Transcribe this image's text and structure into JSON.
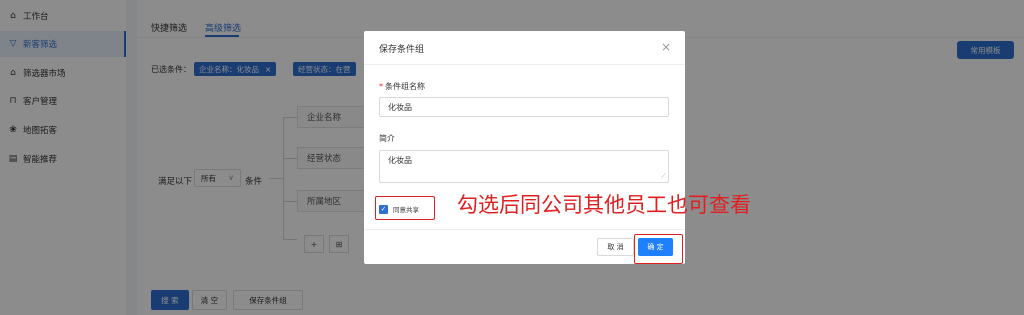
{
  "sidebar": {
    "items": [
      {
        "label": "工作台",
        "icon": "home-icon"
      },
      {
        "label": "新客筛选",
        "icon": "filter-icon",
        "active": true
      },
      {
        "label": "筛选器市场",
        "icon": "store-icon"
      },
      {
        "label": "客户管理",
        "icon": "lock-icon"
      },
      {
        "label": "地图拓客",
        "icon": "map-icon"
      },
      {
        "label": "智能推荐",
        "icon": "document-icon"
      }
    ]
  },
  "tabs": [
    {
      "label": "快捷筛选"
    },
    {
      "label": "高级筛选",
      "active": true
    }
  ],
  "template_button": "常用模板",
  "selected": {
    "label": "已选条件：",
    "chips": [
      {
        "text": "企业名称：化妆品",
        "close": "×"
      },
      {
        "text": "经营状态：在营"
      }
    ]
  },
  "conditions": {
    "prefix": "满足以下",
    "mode": "所有",
    "suffix": "条件",
    "fields": [
      "企业名称",
      "经营状态",
      "所属地区"
    ],
    "add_symbol": "+",
    "group_symbol": "⊞"
  },
  "bottom_buttons": {
    "search": "搜 索",
    "clear": "清 空",
    "save": "保存条件组"
  },
  "modal": {
    "title": "保存条件组",
    "close": "×",
    "name_label": "条件组名称",
    "required_mark": "*",
    "name_value": "化妆品",
    "desc_label": "简介",
    "desc_value": "化妆品",
    "share_label": "同意共享",
    "cancel": "取 消",
    "ok": "确 定"
  },
  "annotation": "勾选后同公司其他员工也可查看",
  "colors": {
    "accent": "#2f6fd0",
    "ok_button": "#1e80ff",
    "annotation_red": "#e02020"
  }
}
